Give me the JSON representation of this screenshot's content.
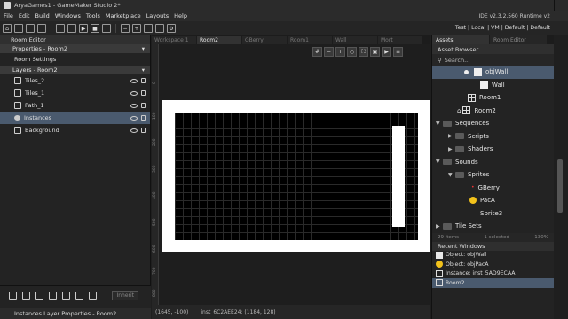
{
  "window": {
    "title": "AryaGames1 - GameMaker Studio 2*"
  },
  "menu": [
    "File",
    "Edit",
    "Build",
    "Windows",
    "Tools",
    "Marketplace",
    "Layouts",
    "Help"
  ],
  "ide_version": "IDE v2.3.2.560  Runtime v2",
  "target_config": "Test | Local | VM | Default | Default",
  "left_panel": {
    "title": "Room Editor",
    "properties_header": "Properties - Room2",
    "room_settings": "Room Settings",
    "layers_header": "Layers - Room2",
    "layers": [
      {
        "name": "Tiles_2",
        "icon": "tiles-icon"
      },
      {
        "name": "Tiles_1",
        "icon": "tiles-icon"
      },
      {
        "name": "Path_1",
        "icon": "path-icon"
      },
      {
        "name": "Instances",
        "icon": "instances-icon",
        "selected": true
      },
      {
        "name": "Background",
        "icon": "background-icon"
      }
    ],
    "inherit_label": "Inherit",
    "instance_layer_properties": "Instances Layer Properties - Room2"
  },
  "tabs": [
    {
      "label": "Workspace 1",
      "active": false
    },
    {
      "label": "Room2",
      "active": true
    },
    {
      "label": "GBerry",
      "active": false
    },
    {
      "label": "Room1",
      "active": false
    },
    {
      "label": "Wall",
      "active": false
    },
    {
      "label": "Mort",
      "active": false
    }
  ],
  "ruler_ticks": [
    "0",
    "100",
    "200",
    "300",
    "400",
    "500",
    "600",
    "700",
    "800"
  ],
  "status": {
    "coords": "(1645, -100)",
    "instance": "inst_6C2AEE24: (1184, 128)"
  },
  "right_panel": {
    "tabs": [
      {
        "label": "Assets",
        "active": true
      },
      {
        "label": "Room Editor",
        "active": false
      }
    ],
    "asset_browser": "Asset Browser",
    "search_placeholder": "Search...",
    "items": [
      {
        "label": "objWall",
        "indent": 3,
        "kind": "object",
        "selected": true
      },
      {
        "label": "Wall",
        "indent": 3,
        "kind": "sprite"
      },
      {
        "label": "Room1",
        "indent": 2,
        "kind": "room"
      },
      {
        "label": "Room2",
        "indent": 2,
        "kind": "room-home"
      },
      {
        "label": "Sequences",
        "indent": 1,
        "kind": "folder",
        "expanded": true
      },
      {
        "label": "Scripts",
        "indent": 1,
        "kind": "folder",
        "expanded": false
      },
      {
        "label": "Shaders",
        "indent": 1,
        "kind": "folder",
        "expanded": false
      },
      {
        "label": "Sounds",
        "indent": 1,
        "kind": "folder",
        "expanded": true
      },
      {
        "label": "Sprites",
        "indent": 1,
        "kind": "folder",
        "expanded": true
      },
      {
        "label": "GBerry",
        "indent": 3,
        "kind": "sprite-dot"
      },
      {
        "label": "PacA",
        "indent": 3,
        "kind": "pac"
      },
      {
        "label": "Sprite3",
        "indent": 3,
        "kind": "blank"
      },
      {
        "label": "Tile Sets",
        "indent": 1,
        "kind": "folder",
        "expanded": false
      }
    ],
    "items_count": "29 items",
    "selected_count": "1 selected",
    "zoom": "130%",
    "recent_header": "Recent Windows",
    "recent": [
      {
        "label": "Object: objWall",
        "icon": "object-icon"
      },
      {
        "label": "Object: objPacA",
        "icon": "pac-icon"
      },
      {
        "label": "Instance: inst_5AD9ECAA",
        "icon": "grid-icon"
      },
      {
        "label": "Room2",
        "icon": "grid-icon",
        "active": true
      }
    ]
  }
}
